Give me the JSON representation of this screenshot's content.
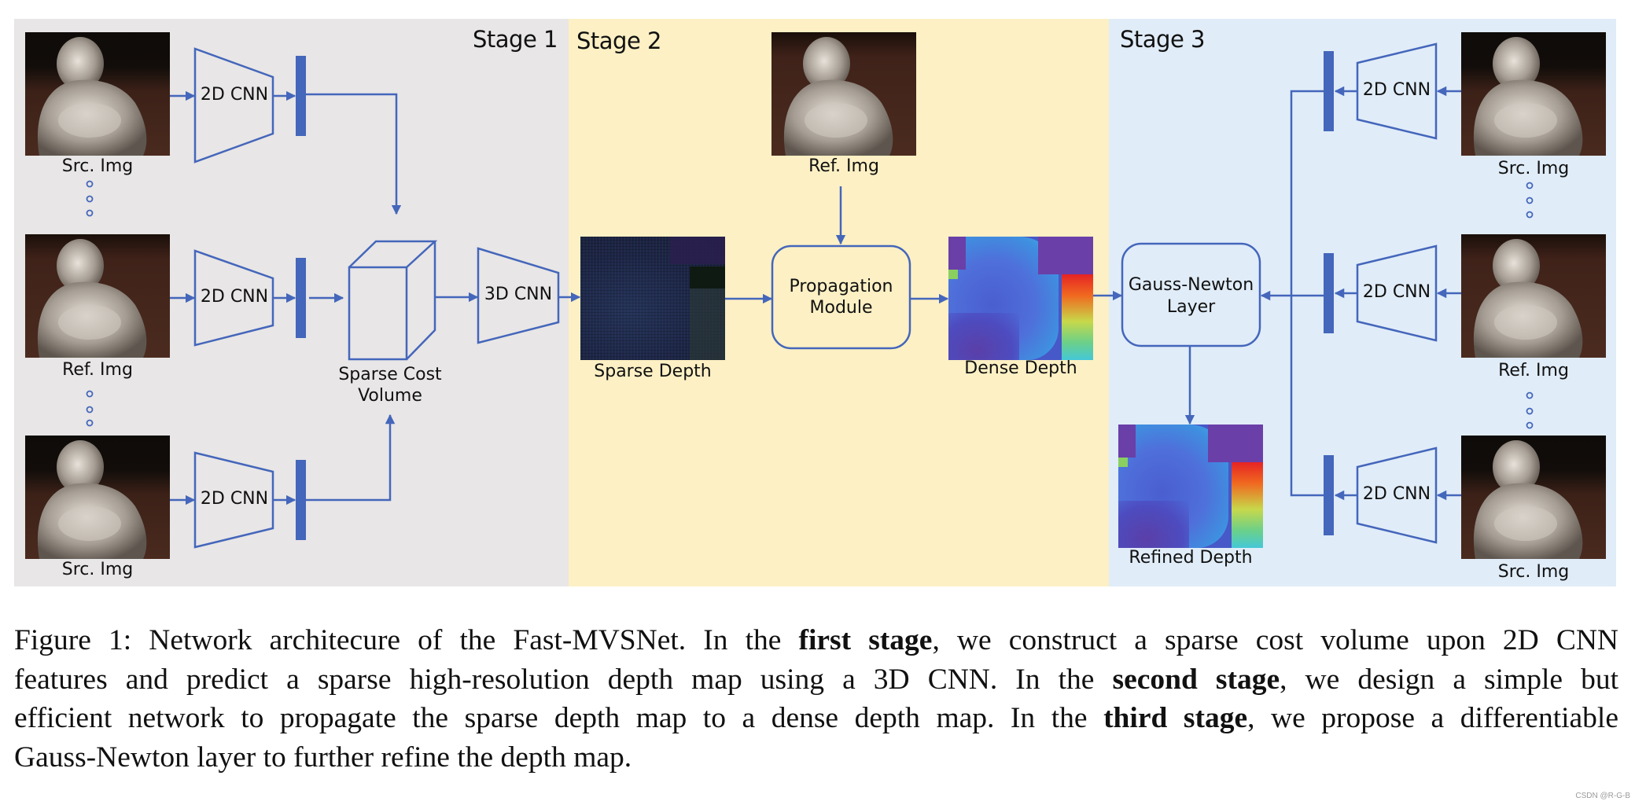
{
  "figure": {
    "stages": [
      {
        "title": "Stage 1",
        "color": "#e8e6e6"
      },
      {
        "title": "Stage 2",
        "color": "#fcf0c4"
      },
      {
        "title": "Stage 3",
        "color": "#e0ecf8"
      }
    ],
    "accent_color": "#4466bb",
    "stage1": {
      "images": [
        "Src. Img",
        "Ref. Img",
        "Src. Img"
      ],
      "encoder_labels": [
        "2D CNN",
        "2D CNN",
        "2D CNN"
      ],
      "cost_volume_label_line1": "Sparse Cost",
      "cost_volume_label_line2": "Volume",
      "regularizer_label": "3D CNN"
    },
    "stage2": {
      "ref_image_label": "Ref. Img",
      "sparse_depth_label": "Sparse Depth",
      "module_label_line1": "Propagation",
      "module_label_line2": "Module",
      "dense_depth_label": "Dense Depth"
    },
    "stage3": {
      "images": [
        "Src. Img",
        "Ref. Img",
        "Src. Img"
      ],
      "encoder_labels": [
        "2D CNN",
        "2D CNN",
        "2D CNN"
      ],
      "layer_label_line1": "Gauss-Newton",
      "layer_label_line2": "Layer",
      "refined_depth_label": "Refined Depth"
    }
  },
  "caption": {
    "line1": {
      "a": "Figure 1: Network architecure of the Fast-MVSNet.  In the ",
      "b": "first stage",
      "c": ", we construct a sparse cost volume upon 2D CNN"
    },
    "line2": {
      "a": "features and predict a sparse high-resolution depth map using a 3D CNN. In the ",
      "b": "second stage",
      "c": ", we design a simple but"
    },
    "line3": {
      "a": "efficient network to propagate the sparse depth map to a dense depth map.  In the ",
      "b": "third stage",
      "c": ", we propose a differentiable"
    },
    "line4": "Gauss-Newton layer to further refine the depth map."
  },
  "watermark": "CSDN @R-G-B"
}
